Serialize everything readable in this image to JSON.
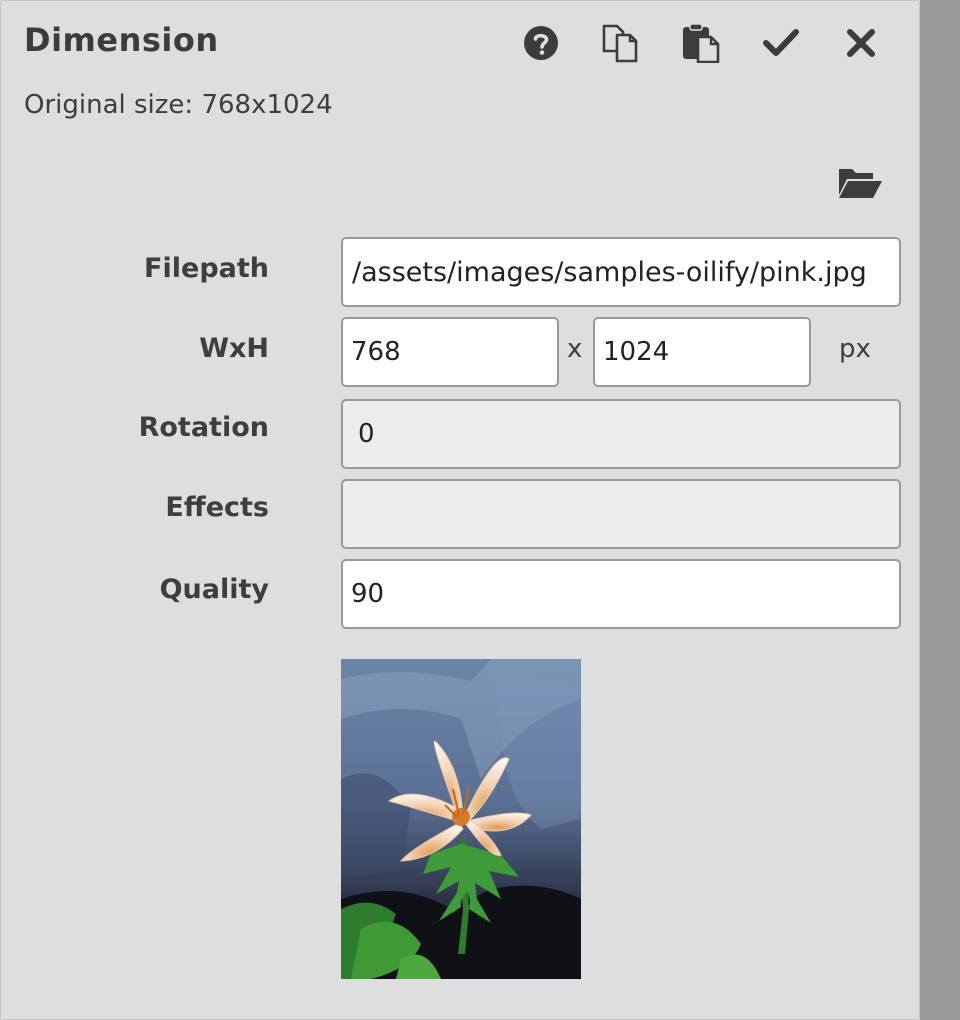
{
  "dialog": {
    "title": "Dimension",
    "original_size": "Original size: 768x1024"
  },
  "toolbar": [
    {
      "name": "help-icon"
    },
    {
      "name": "copy-icon"
    },
    {
      "name": "paste-icon"
    },
    {
      "name": "check-icon"
    },
    {
      "name": "close-icon"
    }
  ],
  "browse": {
    "icon": "folder-open-icon"
  },
  "form": {
    "filepath_label": "Filepath",
    "filepath_value": "/assets/images/samples-oilify/pink.jpg",
    "wxh_label": "WxH",
    "width_value": "768",
    "x_separator": "x",
    "height_value": "1024",
    "unit": "px",
    "rotation_label": "Rotation",
    "rotation_value": "0",
    "effects_label": "Effects",
    "effects_value": "",
    "quality_label": "Quality",
    "quality_value": "90"
  },
  "preview": {
    "description_icon": "image-preview"
  },
  "colors": {
    "panel_bg": "#dedede",
    "field_border": "#9a9a9a",
    "readonly_bg": "#ececec",
    "scrollbar": "#9b9b9b",
    "icon": "#3c3c3c"
  }
}
